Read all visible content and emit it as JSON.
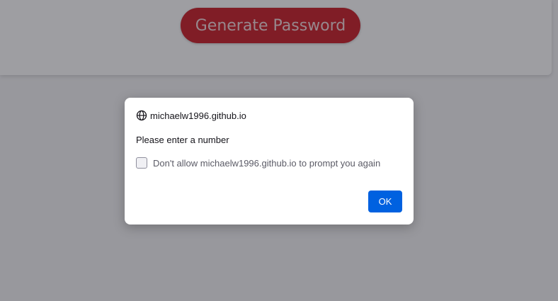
{
  "page": {
    "generate_button_label": "Generate Password"
  },
  "dialog": {
    "origin": "michaelw1996.github.io",
    "message": "Please enter a number",
    "checkbox_label": "Don't allow michaelw1996.github.io to prompt you again",
    "checkbox_checked": false,
    "ok_label": "OK"
  },
  "icons": {
    "origin": "globe-icon"
  },
  "colors": {
    "generate_button": "#c8141e",
    "ok_button": "#0061e0"
  }
}
